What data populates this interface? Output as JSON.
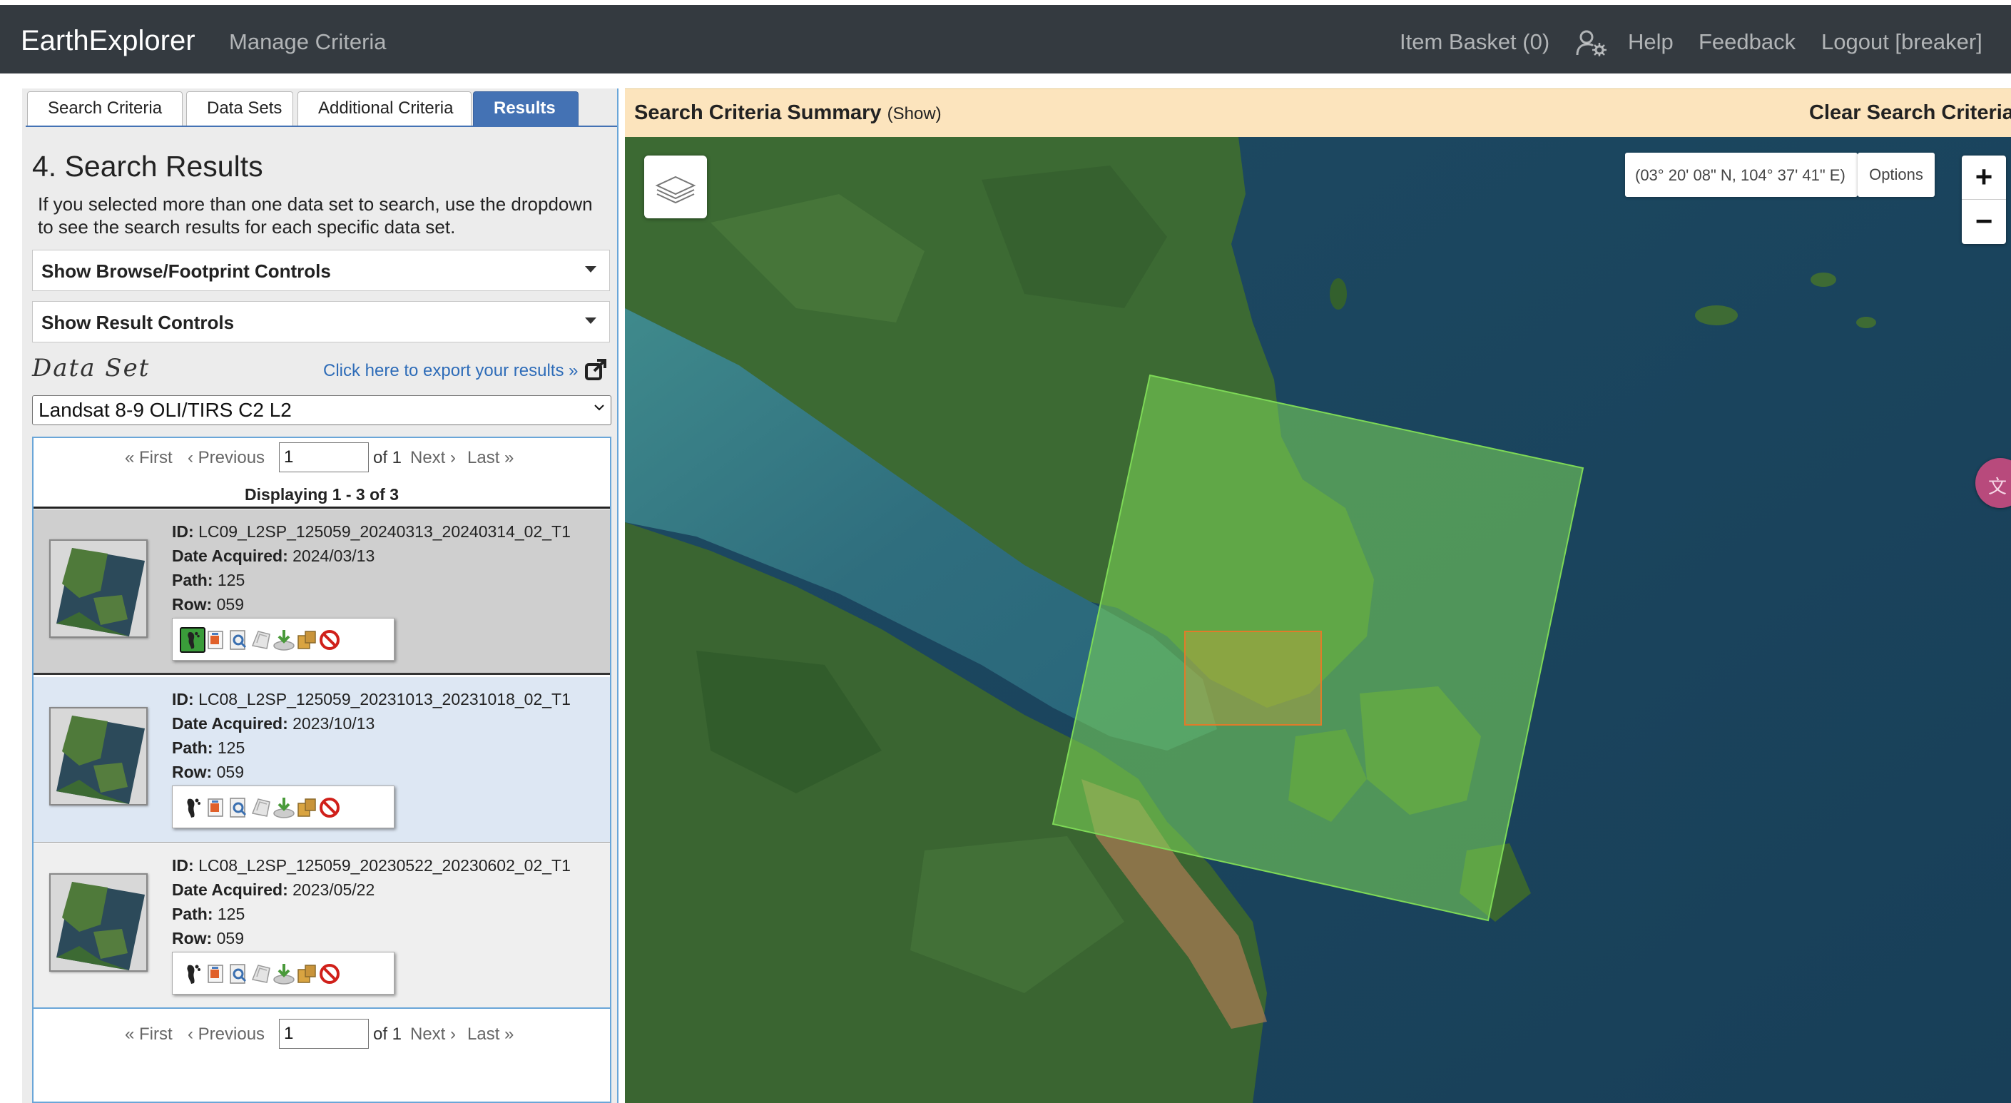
{
  "navbar": {
    "brand": "EarthExplorer",
    "manage": "Manage Criteria",
    "basket": "Item Basket (0)",
    "help": "Help",
    "feedback": "Feedback",
    "logout": "Logout [breaker]",
    "settings_icon": "user-gear-icon"
  },
  "tabs": [
    "Search Criteria",
    "Data Sets",
    "Additional Criteria",
    "Results"
  ],
  "active_tab": "Results",
  "results": {
    "title": "4. Search Results",
    "description": "If you selected more than one data set to search, use the dropdown to see the search results for each specific data set.",
    "browse_controls": "Show Browse/Footprint Controls",
    "result_controls": "Show Result Controls",
    "dataset_label": "Data Set",
    "export_link": "Click here to export your results »",
    "dataset_selected": "Landsat 8-9 OLI/TIRS C2 L2",
    "pager": {
      "first": "« First",
      "previous": "‹ Previous",
      "page": "1",
      "of": "of 1",
      "next": "Next ›",
      "last": "Last »"
    },
    "displaying": "Displaying 1 - 3 of 3",
    "labels": {
      "id": "ID:",
      "date": "Date Acquired:",
      "path": "Path:",
      "row": "Row:"
    },
    "items": [
      {
        "id": "LC09_L2SP_125059_20240313_20240314_02_T1",
        "date": "2024/03/13",
        "path": "125",
        "row": "059",
        "footprint_active": true
      },
      {
        "id": "LC08_L2SP_125059_20231013_20231018_02_T1",
        "date": "2023/10/13",
        "path": "125",
        "row": "059",
        "footprint_active": false
      },
      {
        "id": "LC08_L2SP_125059_20230522_20230602_02_T1",
        "date": "2023/05/22",
        "path": "125",
        "row": "059",
        "footprint_active": false
      }
    ],
    "tool_icons": [
      "footprint-icon",
      "browse-overlay-icon",
      "metadata-icon",
      "compare-icon",
      "download-icon",
      "order-icon",
      "exclude-icon"
    ]
  },
  "map": {
    "summary_title": "Search Criteria Summary",
    "summary_show": "(Show)",
    "clear": "Clear Search Criteria",
    "coordinates": "(03° 20' 08\" N, 104° 37' 41\" E)",
    "options": "Options",
    "zoom_in": "+",
    "zoom_out": "−",
    "translate_glyph": "文",
    "colors": {
      "footprint": "#7ed957",
      "aoi": "#e07b2a",
      "water": "#1f4d66",
      "land": "#3f6b35"
    }
  }
}
